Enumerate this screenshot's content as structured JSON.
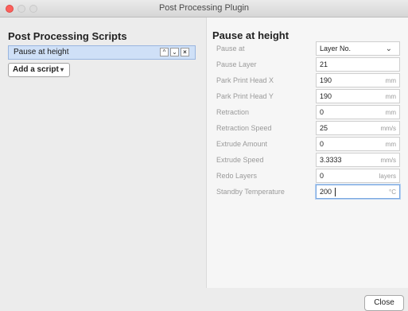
{
  "window": {
    "title": "Post Processing Plugin"
  },
  "left": {
    "heading": "Post Processing Scripts",
    "selected_script": "Pause at height",
    "buttons": {
      "up": "^",
      "down": "⌄",
      "remove": "×"
    },
    "add_label": "Add a script",
    "add_arrow": "▾"
  },
  "right": {
    "heading": "Pause at height",
    "fields": [
      {
        "label": "Pause at",
        "value": "Layer No.",
        "unit": ""
      },
      {
        "label": "Pause Layer",
        "value": "21",
        "unit": ""
      },
      {
        "label": "Park Print Head X",
        "value": "190",
        "unit": "mm"
      },
      {
        "label": "Park Print Head Y",
        "value": "190",
        "unit": "mm"
      },
      {
        "label": "Retraction",
        "value": "0",
        "unit": "mm"
      },
      {
        "label": "Retraction Speed",
        "value": "25",
        "unit": "mm/s"
      },
      {
        "label": "Extrude Amount",
        "value": "0",
        "unit": "mm"
      },
      {
        "label": "Extrude Speed",
        "value": "3.3333",
        "unit": "mm/s"
      },
      {
        "label": "Redo Layers",
        "value": "0",
        "unit": "layers"
      },
      {
        "label": "Standby Temperature",
        "value": "200",
        "unit": "°C"
      }
    ],
    "dropdown_chevron": "⌄"
  },
  "footer": {
    "close_label": "Close"
  }
}
